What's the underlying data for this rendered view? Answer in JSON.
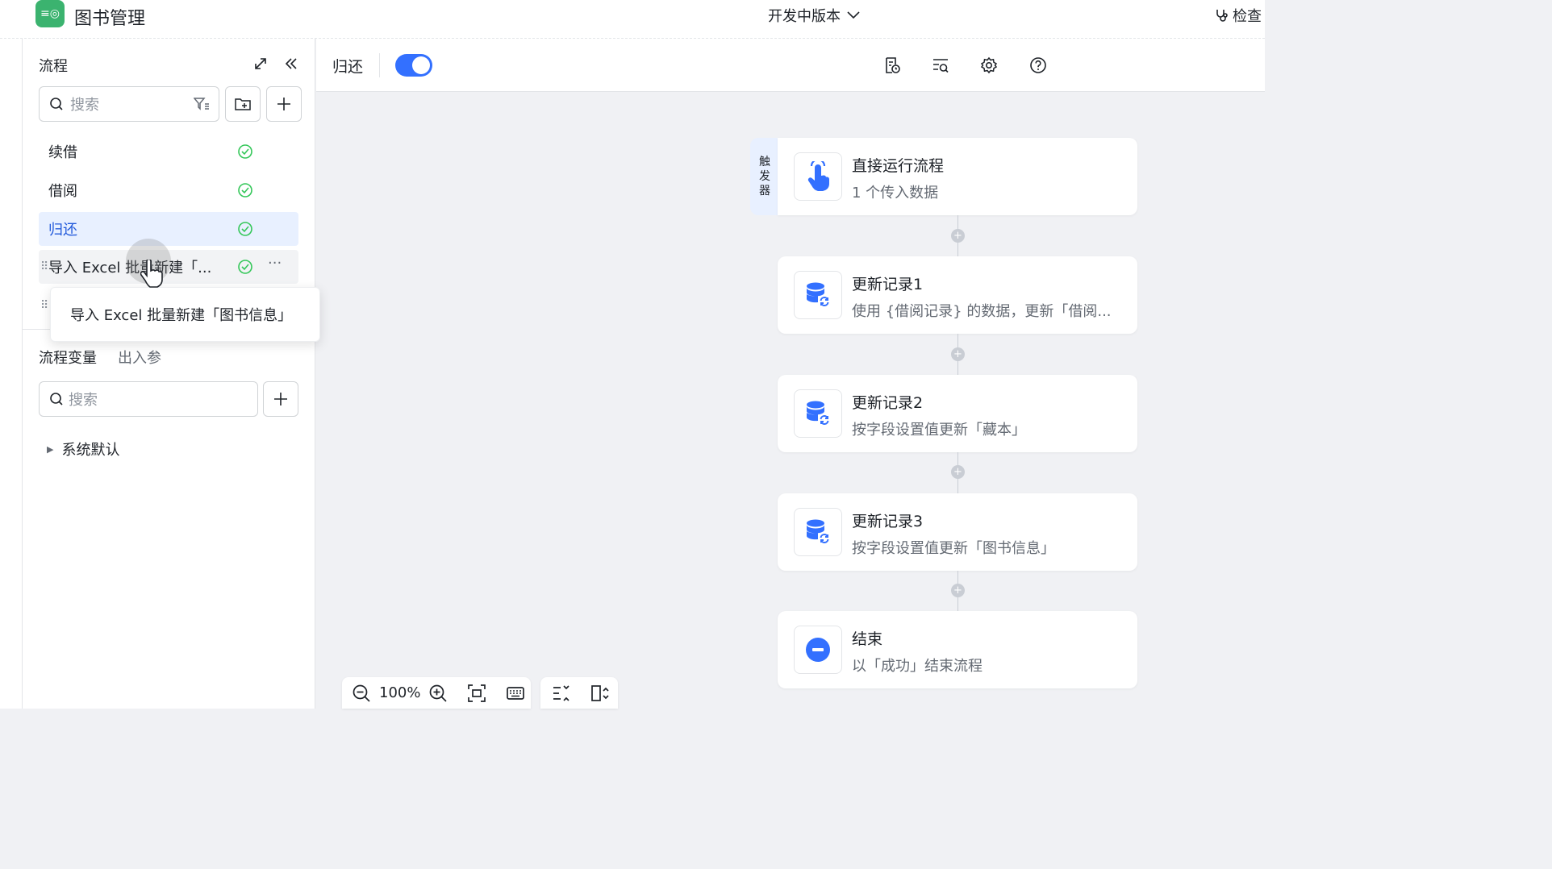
{
  "app": {
    "icon_label": "≡◎",
    "title": "图书管理",
    "version": "开发中版本",
    "inspect": "检查"
  },
  "sidebar": {
    "title": "流程",
    "search_placeholder": "搜索",
    "flows": [
      {
        "label": "续借",
        "status": "ok"
      },
      {
        "label": "借阅",
        "status": "ok"
      },
      {
        "label": "归还",
        "status": "ok"
      },
      {
        "label": "导入 Excel 批量新建「...",
        "status": "ok"
      }
    ],
    "tooltip": "导入 Excel 批量新建「图书信息」",
    "tabs": [
      "流程变量",
      "出入参"
    ],
    "var_search_placeholder": "搜索",
    "tree_item": "系统默认"
  },
  "canvas": {
    "flow_name": "归还",
    "enabled": true,
    "trigger_tag": [
      "触",
      "发",
      "器"
    ],
    "nodes": [
      {
        "title": "直接运行流程",
        "subtitle": "1 个传入数据",
        "icon": "hand-pointer-icon"
      },
      {
        "title": "更新记录1",
        "subtitle": "使用 {借阅记录} 的数据，更新「借阅...",
        "icon": "database-update-icon"
      },
      {
        "title": "更新记录2",
        "subtitle": "按字段设置值更新「藏本」",
        "icon": "database-update-icon"
      },
      {
        "title": "更新记录3",
        "subtitle": "按字段设置值更新「图书信息」",
        "icon": "database-update-icon"
      },
      {
        "title": "结束",
        "subtitle": "以「成功」结束流程",
        "icon": "end-icon"
      }
    ],
    "zoom": "100%"
  },
  "colors": {
    "accent": "#3370ff",
    "success": "#34c759",
    "active_bg": "#e8f0ff"
  }
}
